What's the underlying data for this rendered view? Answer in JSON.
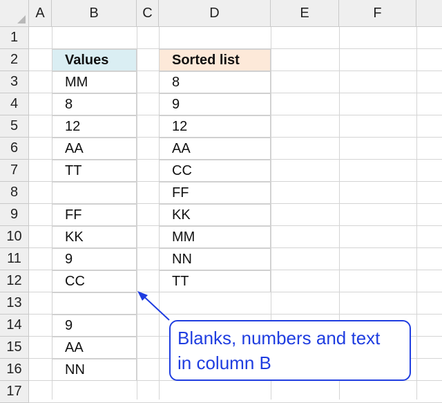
{
  "columns": [
    "A",
    "B",
    "C",
    "D",
    "E",
    "F"
  ],
  "rows": [
    "1",
    "2",
    "3",
    "4",
    "5",
    "6",
    "7",
    "8",
    "9",
    "10",
    "11",
    "12",
    "13",
    "14",
    "15",
    "16",
    "17"
  ],
  "column_b": {
    "header": "Values",
    "values": [
      "MM",
      "8",
      "12",
      "AA",
      "TT",
      "",
      "FF",
      "KK",
      "9",
      "CC",
      "",
      "9",
      "AA",
      "NN"
    ]
  },
  "column_d": {
    "header": "Sorted list",
    "values": [
      "8",
      "9",
      "12",
      "AA",
      "CC",
      "FF",
      "KK",
      "MM",
      "NN",
      "TT"
    ]
  },
  "callout": {
    "line1": "Blanks, numbers and text",
    "line2": "in column B"
  },
  "colors": {
    "header_b_fill": "#daeef3",
    "header_d_fill": "#fde9d9",
    "callout_accent": "#1f3de0"
  }
}
